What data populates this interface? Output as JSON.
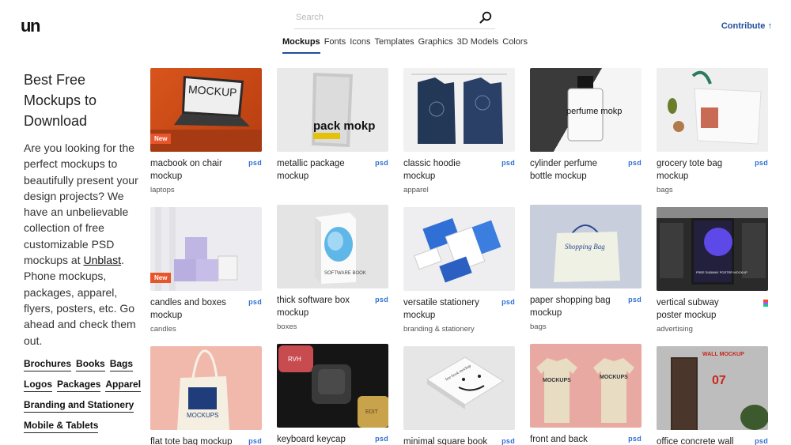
{
  "header": {
    "logo": "un",
    "search_placeholder": "Search",
    "contribute_label": "Contribute ↑"
  },
  "tabs": [
    {
      "label": "Mockups",
      "active": true
    },
    {
      "label": "Fonts"
    },
    {
      "label": "Icons"
    },
    {
      "label": "Templates"
    },
    {
      "label": "Graphics"
    },
    {
      "label": "3D Models"
    },
    {
      "label": "Colors"
    }
  ],
  "sidebar": {
    "heading": "Best Free Mockups to Download",
    "intro_before": "Are you looking for the perfect mockups to beautifully present your design projects? We have an unbelievable collection of free customizable PSD mockups at ",
    "intro_link": "Unblast",
    "intro_after": ". Phone mockups, packages, apparel, flyers, posters, etc. Go ahead and check them out.",
    "categories": [
      "Brochures",
      "Books",
      "Bags",
      "Logos",
      "Packages",
      "Apparel",
      "Branding and Stationery",
      "Mobile & Tablets"
    ]
  },
  "items": [
    {
      "title": "macbook on chair mockup",
      "tag": "laptops",
      "format": "psd",
      "badge": "New"
    },
    {
      "title": "metallic package mockup",
      "tag": "",
      "format": "psd"
    },
    {
      "title": "classic hoodie mockup",
      "tag": "apparel",
      "format": "psd"
    },
    {
      "title": "cylinder perfume bottle mockup",
      "tag": "",
      "format": "psd"
    },
    {
      "title": "grocery tote bag mockup",
      "tag": "bags",
      "format": "psd"
    },
    {
      "title": "candles and boxes mockup",
      "tag": "candles",
      "format": "psd",
      "badge": "New"
    },
    {
      "title": "thick software box mockup",
      "tag": "boxes",
      "format": "psd"
    },
    {
      "title": "versatile stationery mockup",
      "tag": "branding & stationery",
      "format": "psd"
    },
    {
      "title": "paper shopping bag mockup",
      "tag": "bags",
      "format": "psd"
    },
    {
      "title": "vertical subway poster mockup",
      "tag": "advertising",
      "format": "fig"
    },
    {
      "title": "flat tote bag mockup",
      "tag": "",
      "format": "psd"
    },
    {
      "title": "keyboard keycap",
      "tag": "",
      "format": "psd"
    },
    {
      "title": "minimal square book",
      "tag": "",
      "format": "psd"
    },
    {
      "title": "front and back",
      "tag": "",
      "format": "psd"
    },
    {
      "title": "office concrete wall",
      "tag": "",
      "format": "psd"
    }
  ],
  "thumb_text": {
    "macbook": "MOCKUP",
    "package": "pack mokp",
    "perfume": "perfume mokp",
    "shopping_bag": "Shopping Bag",
    "software": "SOFTWARE BOOK",
    "subway": "FREE SUBWAY POSTER MOCKUP",
    "tote": "MOCKUPS",
    "keycap_1": "RVH",
    "keycap_2": "EDIT",
    "book": "free book mockup",
    "tshirt": "MOCKUPS",
    "wall": "WALL MOCKUP",
    "wall_num": "07"
  },
  "colors": {
    "accent": "#1f4f9a",
    "badge": "#e8552a",
    "psd": "#2e6fd1"
  }
}
